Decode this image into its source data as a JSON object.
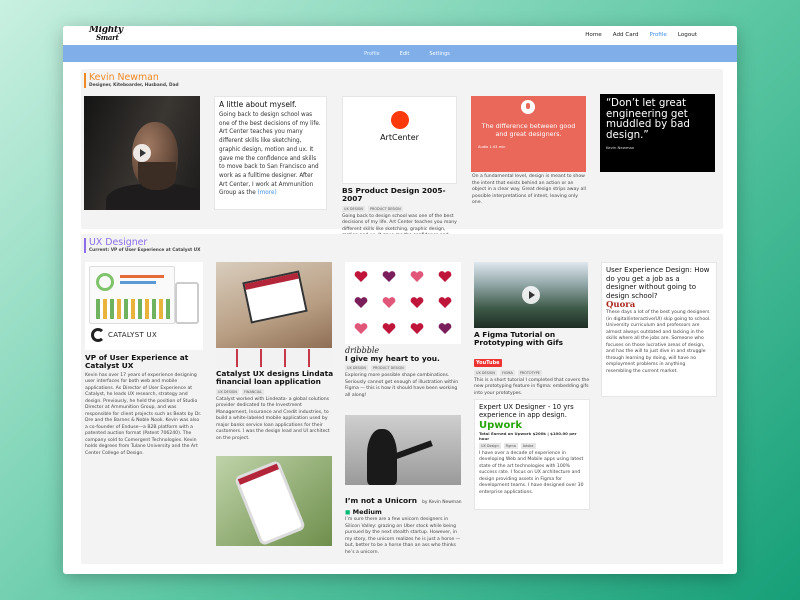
{
  "nav": {
    "logo_line1": "Mighty",
    "logo_line2": "Smart",
    "links": [
      "Home",
      "Add Card",
      "Profile",
      "Logout"
    ],
    "active": "Profile"
  },
  "subnav": {
    "tabs": [
      "Profile",
      "Edit",
      "Settings"
    ],
    "active": "Profile"
  },
  "profile": {
    "name": "Kevin Newman",
    "tagline": "Designer, Kiteboarder, Husband, Dad",
    "about": {
      "title": "A little about myself.",
      "body": "Going back to design school was one of the best decisions of my life. Art Center teaches you many different skills like sketching, graphic design, motion and ux. It gave me the confidence and skills to move back to San Francisco and work as a fulltime designer. After Art Center, I work at Ammunition Group as the",
      "more": "(more)"
    },
    "artcenter": {
      "logo": "ArtCenter",
      "title": "BS Product Design 2005-2007",
      "tags": [
        "UX DESIGN",
        "PRODUCT DESIGN"
      ],
      "desc": "Going back to design school was one of the best decisions of my life. Art Center teaches you many different skills like sketching, graphic design, motion and ux. It gave me the confidence and skills to move back to San Francisco and work as a fulltime designer."
    },
    "podcast": {
      "heading": "The difference between good and great designers.",
      "audio": "Audio  1:43 min",
      "desc": "On a fundamental level, design is meant to show the intent that exists behind an action or an object in a clear way. Great design strips away all possible interpretations of intent, leaving only one."
    },
    "quote": {
      "text": "“Don’t let great engineering get muddled by bad design.”",
      "author": "Kevin Newman"
    }
  },
  "ux": {
    "title": "UX Designer",
    "subtitle": "Current: VP of User Experience at Catalyst UX",
    "catalyst": {
      "logo": "CATALYST UX",
      "title": "VP of User Experience at Catalyst UX",
      "desc": "Kevin has over 17 years of experience designing user interfaces for both web and mobile applications. As Director of User Experience at Catalyst, he leads UX research, strategy and design. Previously, he held the position of Studio Director at Ammunition Group, and was responsible for client projects such as Beats by Dr. Dre and the Barnes & Noble Nook. Kevin was also a co-founder of Enduse—a B2B platform with a patented auction format (Patent 706240). The company sold to Comergent Technologies. Kevin holds degrees from Tulane University and the Art Center College of Design."
    },
    "lindeta": {
      "title": "Catalyst UX designs Lindata financial loan application",
      "tags": [
        "UX DESIGN",
        "FINANCIAL"
      ],
      "desc": "Catalyst worked with Lindeata- a global solutions provider dedicated to the Investment Management, Insurance and Credit industries, to build a white-labeled mobile application used by major banks service loan applications for their customers. I was the design lead and UI architect on the project."
    },
    "dribbble": {
      "logo": "dribbble",
      "title": "I give my heart to you.",
      "tags": [
        "UX DESIGN",
        "PRODUCT DESIGN"
      ],
      "desc": "Exploring more possible shape combinations. Seriously cannot get enough of illustration within Figma — this is how it should have been working all along!"
    },
    "unicorn": {
      "title": "I’m not a Unicorn",
      "by": "by Kevin Newman",
      "source": "Medium",
      "desc": "I’m sure there are a few unicorn designers in Silicon Valley: grazing on Uber stock while being pursued by the next stealth startup. However, in my story, the unicorn realizes he is just a horse — but, better to be a horse than an ass who thinks he’s a unicorn."
    },
    "figma": {
      "title": "A Figma Tutorial on Prototyping with Gifs",
      "source": "YouTube",
      "tags": [
        "UX DESIGN",
        "FIGMA",
        "PROTOTYPE"
      ],
      "desc": "This is a short tutorial I completed that covers the new prototyping feature in figma: embedding gifs into your prototypes."
    },
    "upwork": {
      "title": "Expert UX Designer - 10 yrs experience in app design.",
      "source": "Upwork",
      "earned": "Total Earned on Upwork $200k | $100.00 per hour",
      "tags": [
        "UX Design",
        "Figma",
        "Adobe"
      ],
      "desc": "I have over a decade of experience in developing Web and Mobile apps using latest state of the art technologies with 100% success rate. I focus on UX architecture and design providing assets in Figma for development teams. I have designed over 30 enterprise applications."
    },
    "quora": {
      "title": "User Experience Design: How do you get a job as a designer without going to design school?",
      "source": "Quora",
      "desc": "These days a lot of the best young designers (in digital/interactive/UI) skip going to school. University curriculum and professors are almost always outdated and lacking in the skills where all the jobs are. Someone who focuses on those lucrative areas of design, and has the will to just dive in and struggle through learning by doing, will have no employment problems in anything resembling the current market."
    },
    "heart_colors": [
      "#c0153a",
      "#7a1f5c",
      "#e0577a",
      "#c0153a"
    ]
  }
}
